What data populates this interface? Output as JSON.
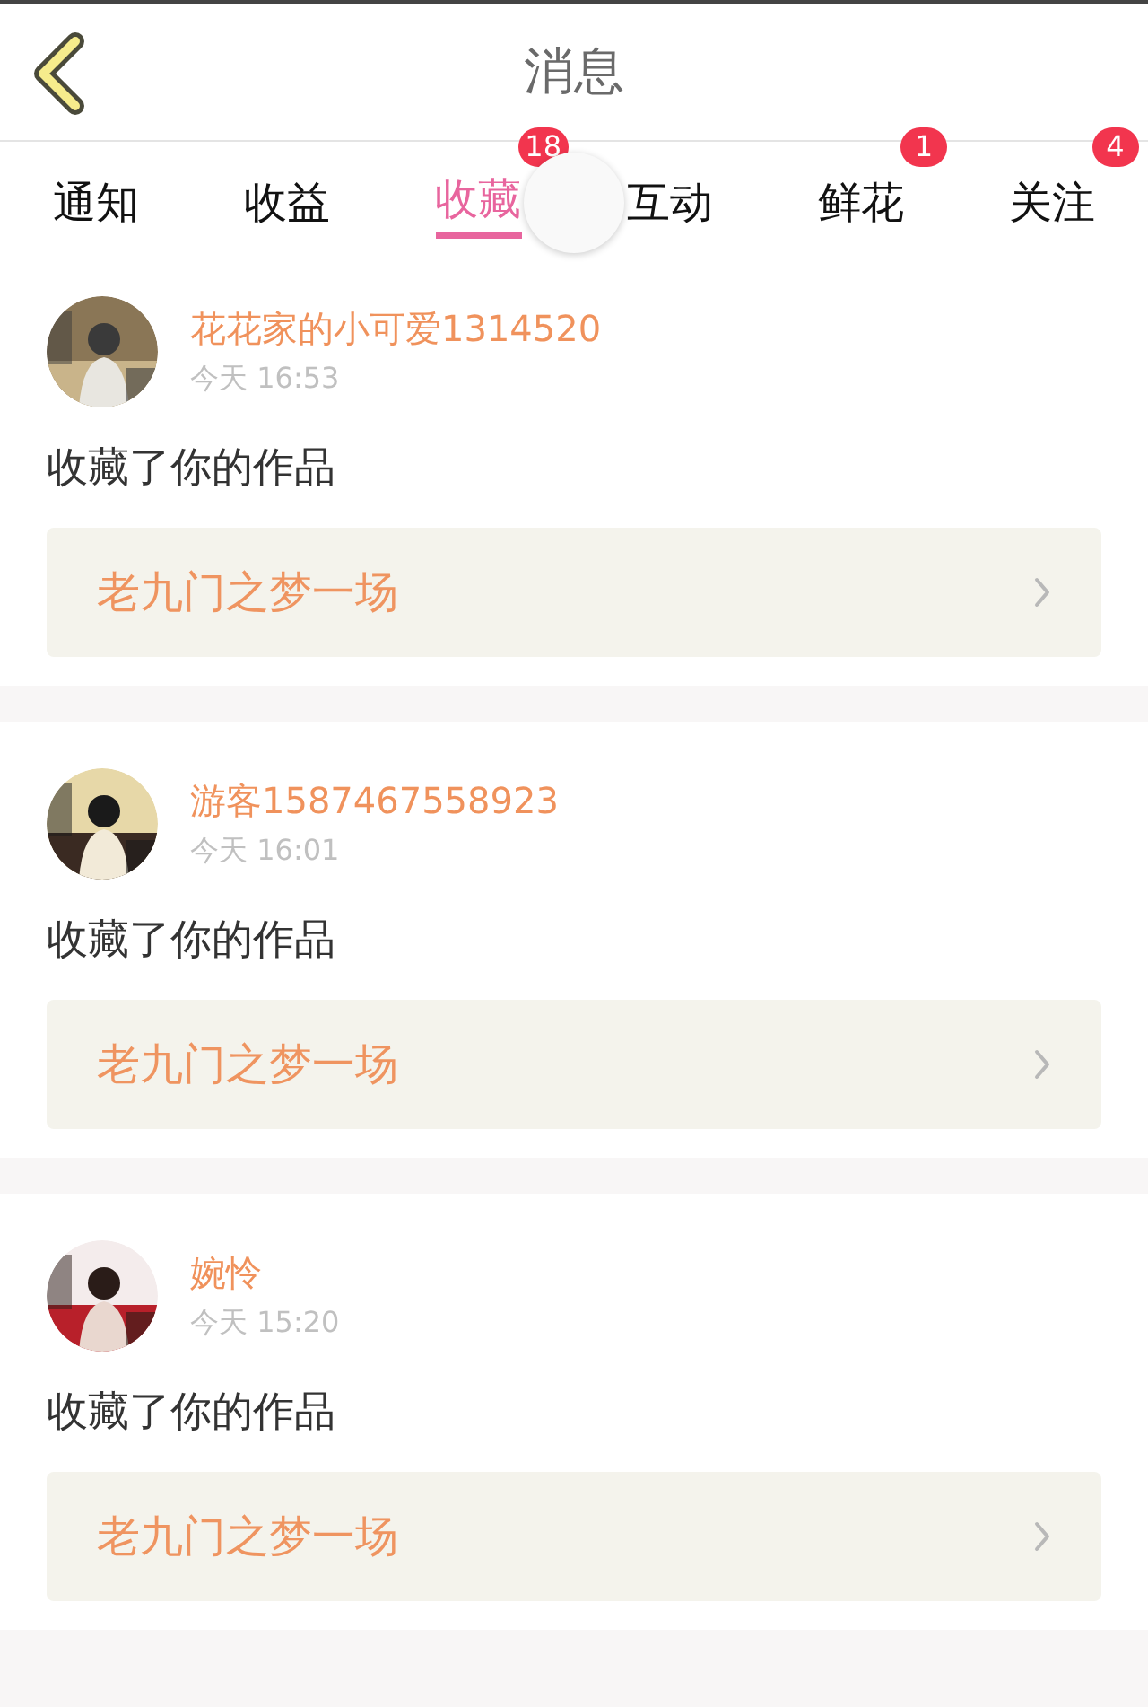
{
  "header": {
    "title": "消息"
  },
  "tabs": [
    {
      "label": "通知",
      "selected": false
    },
    {
      "label": "收益",
      "selected": false
    },
    {
      "label": "收藏",
      "selected": true,
      "badge": "18"
    },
    {
      "label": "互动",
      "selected": false
    },
    {
      "label": "鲜花",
      "selected": false,
      "badge": "1"
    },
    {
      "label": "关注",
      "selected": false,
      "badge": "4"
    }
  ],
  "messages": [
    {
      "name": "花花家的小可爱1314520",
      "time": "今天 16:53",
      "action": "收藏了你的作品",
      "work": "老九门之梦一场"
    },
    {
      "name": "游客1587467558923",
      "time": "今天 16:01",
      "action": "收藏了你的作品",
      "work": "老九门之梦一场"
    },
    {
      "name": "婉怜",
      "time": "今天 15:20",
      "action": "收藏了你的作品",
      "work": "老九门之梦一场"
    }
  ]
}
